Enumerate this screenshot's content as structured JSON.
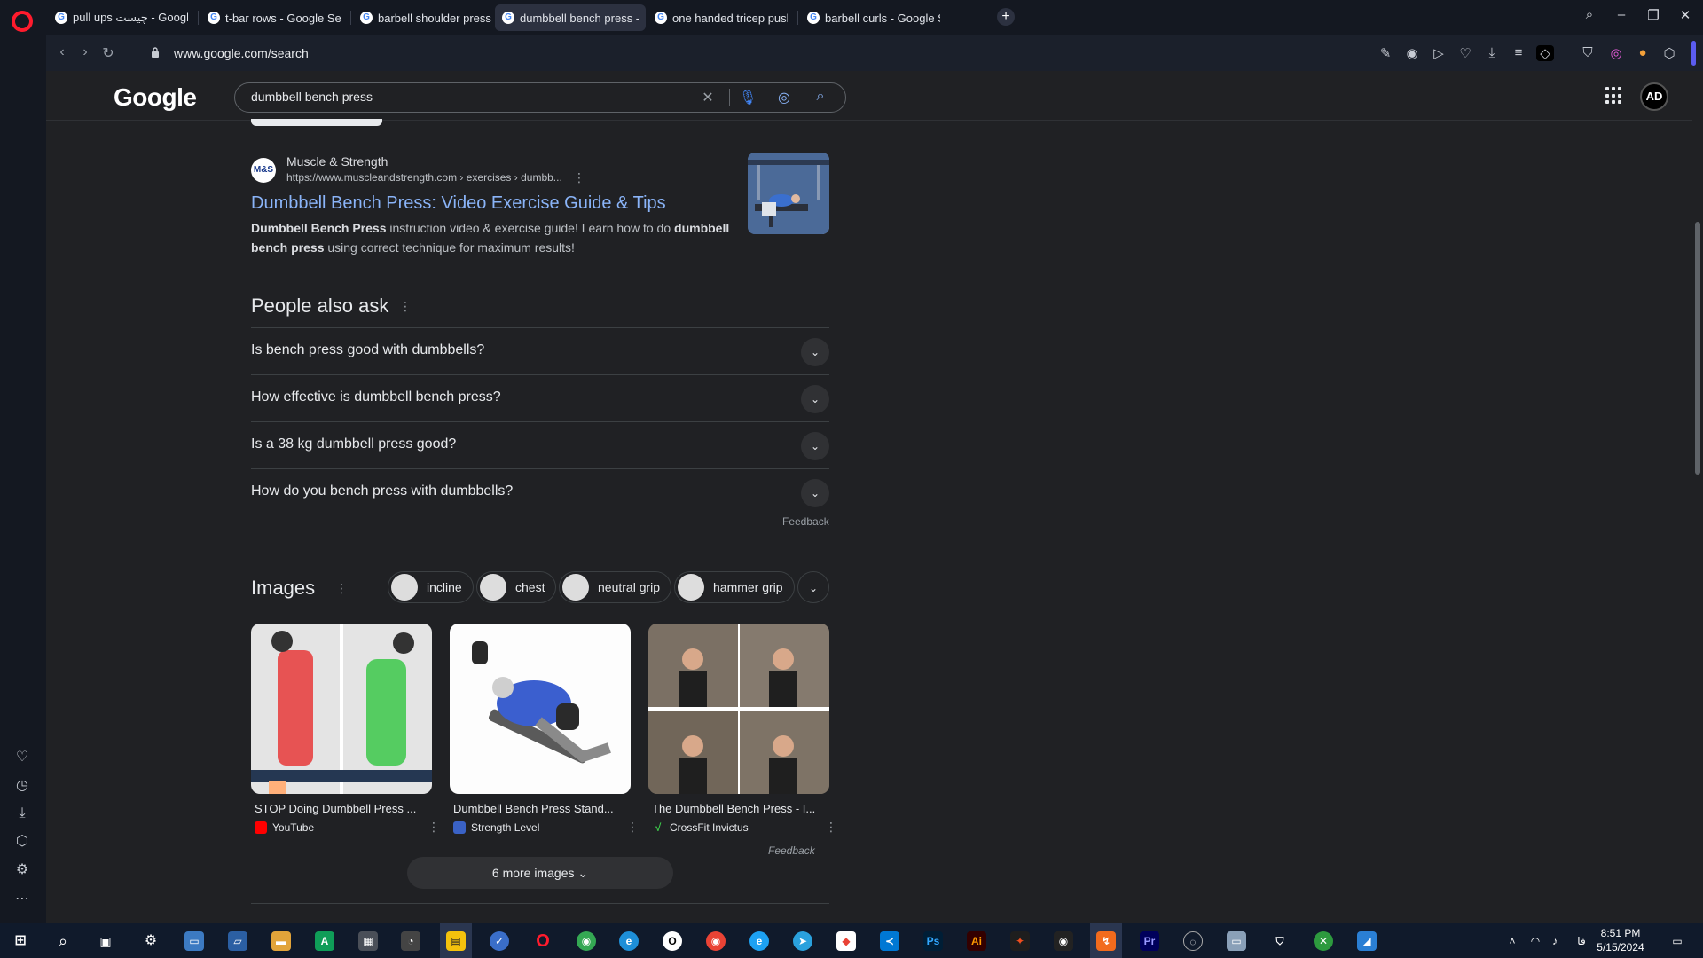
{
  "browser": {
    "tabs": [
      {
        "title": "pull ups چیست - Google S"
      },
      {
        "title": "t-bar rows - Google Searc"
      },
      {
        "title": "barbell shoulder press - G"
      },
      {
        "title": "dumbbell bench press - G"
      },
      {
        "title": "one handed tricep pushdo"
      },
      {
        "title": "barbell curls - Google Sea"
      }
    ],
    "active_tab": 3,
    "url": "www.google.com/search"
  },
  "google": {
    "logo": "Google",
    "query": "dumbbell bench press",
    "avatar_text": "AD"
  },
  "result": {
    "site_name": "Muscle & Strength",
    "site_icon_text": "M&S",
    "url": "https://www.muscleandstrength.com › exercises › dumbb...",
    "title": "Dumbbell Bench Press: Video Exercise Guide & Tips",
    "snippet_b1": "Dumbbell Bench Press",
    "snippet_t1": " instruction video & exercise guide! Learn how to do ",
    "snippet_b2": "dumbbell bench press",
    "snippet_t2": " using correct technique for maximum results!"
  },
  "paa": {
    "heading": "People also ask",
    "questions": [
      "Is bench press good with dumbbells?",
      "How effective is dumbbell bench press?",
      "Is a 38 kg dumbbell press good?",
      "How do you bench press with dumbbells?"
    ],
    "feedback": "Feedback"
  },
  "images": {
    "heading": "Images",
    "chips": [
      "incline",
      "chest",
      "neutral grip",
      "hammer grip"
    ],
    "cards": [
      {
        "title": "STOP Doing Dumbbell Press ...",
        "source": "YouTube"
      },
      {
        "title": "Dumbbell Bench Press Stand...",
        "source": "Strength Level"
      },
      {
        "title": "The Dumbbell Bench Press - I...",
        "source": "CrossFit Invictus"
      }
    ],
    "feedback": "Feedback",
    "more": "6 more images"
  },
  "taskbar": {
    "time": "8:51 PM",
    "date": "5/15/2024",
    "lang": "فا"
  },
  "colors": {
    "link": "#8ab4f8",
    "page_bg": "#202124",
    "opera_red": "#ff1b2d"
  }
}
